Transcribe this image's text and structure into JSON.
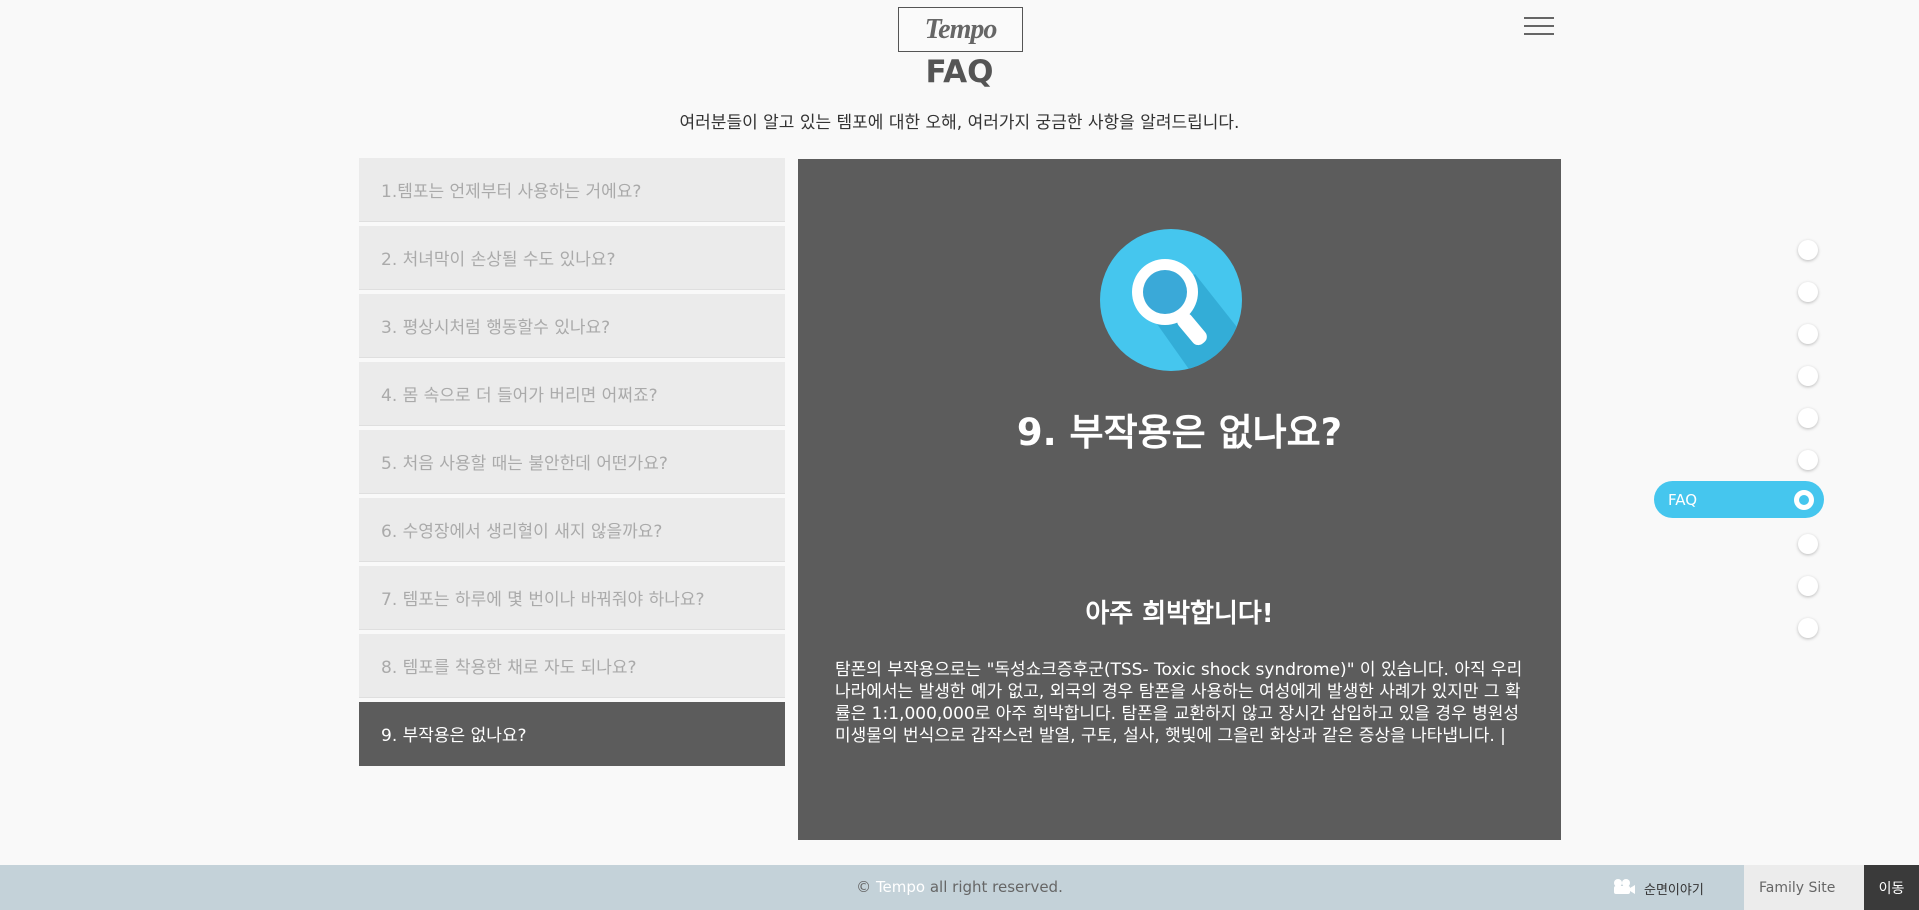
{
  "header": {
    "logo_text": "Tempo",
    "menu_icon": "hamburger-icon"
  },
  "page": {
    "title": "FAQ",
    "subtitle": "여러분들이 알고 있는 템포에 대한 오해, 여러가지 궁금한 사항을 알려드립니다."
  },
  "faq": {
    "items": [
      {
        "label": "1.템포는 언제부터 사용하는 거에요?"
      },
      {
        "label": "2. 처녀막이 손상될 수도 있나요?"
      },
      {
        "label": "3. 평상시처럼 행동할수 있나요?"
      },
      {
        "label": "4. 몸 속으로 더 들어가 버리면 어쩌죠?"
      },
      {
        "label": "5. 처음 사용할 때는 불안한데 어떤가요?"
      },
      {
        "label": "6. 수영장에서 생리혈이 새지 않을까요?"
      },
      {
        "label": "7. 템포는 하루에 몇 번이나 바꿔줘야 하나요?"
      },
      {
        "label": "8. 템포를 착용한 채로 자도 되나요?"
      },
      {
        "label": "9. 부작용은 없나요?"
      }
    ],
    "active_index": 8
  },
  "answer": {
    "icon": "search-icon",
    "icon_colors": {
      "circle": "#45c6ee",
      "shadow": "#2ea4cf",
      "lens": "#3aa9d8"
    },
    "title": "9. 부작용은 없나요?",
    "subtitle": "아주 희박합니다!",
    "body": "탐폰의 부작용으로는 \"독성쇼크증후군(TSS- Toxic shock syndrome)\" 이 있습니다. 아직 우리나라에서는 발생한 예가 없고, 외국의 경우 탐폰을 사용하는 여성에게 발생한 사례가 있지만 그 확률은 1:1,000,000로 아주 희박합니다. 탐폰을 교환하지 않고 장시간 삽입하고 있을 경우 병원성 미생물의 번식으로 갑작스런 발열, 구토, 설사, 햇빛에 그을린 화상과 같은 증상을 나타냅니다. |"
  },
  "side_nav": {
    "active_label": "FAQ",
    "accent": "#45c6ee"
  },
  "footer": {
    "copyright_prefix": "© ",
    "copyright_brand": "Tempo",
    "copyright_suffix": " all right reserved.",
    "story_label": "순면이야기",
    "family_site_label": "Family Site",
    "go_label": "이동",
    "background": "#c4d2d9"
  }
}
